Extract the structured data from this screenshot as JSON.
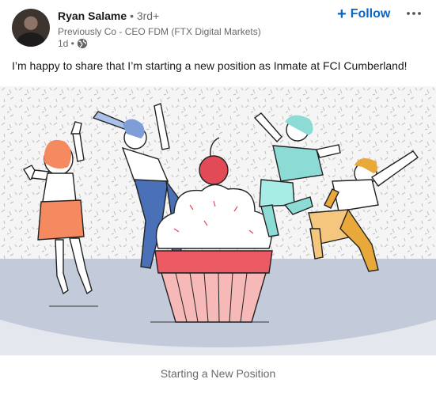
{
  "author": {
    "name": "Ryan Salame",
    "degree": "• 3rd+",
    "headline": "Previously Co - CEO FDM (FTX Digital Markets)",
    "time": "1d •"
  },
  "actions": {
    "follow_icon": "plus-icon",
    "follow_label": "Follow",
    "more_icon": "ellipsis-icon"
  },
  "post": {
    "text": "I’m happy to share that I’m starting a new position as Inmate at FCI Cumberland!"
  },
  "illustration": {
    "caption": "Starting a New Position",
    "colors": {
      "background": "#f5f5f5",
      "floor": "#c3cad9",
      "cherry": "#e24a57",
      "frosting": "#ffffff",
      "cup_top": "#ec5a64",
      "cup": "#f6b9b8",
      "orange": "#f5895f",
      "blue": "#4a70b7",
      "teal": "#8ddbd5",
      "yellow": "#f5c77e",
      "mustard": "#e9a83a"
    }
  },
  "colors": {
    "accent": "#0a66c2",
    "text_primary": "#191919",
    "text_secondary": "#666666"
  }
}
